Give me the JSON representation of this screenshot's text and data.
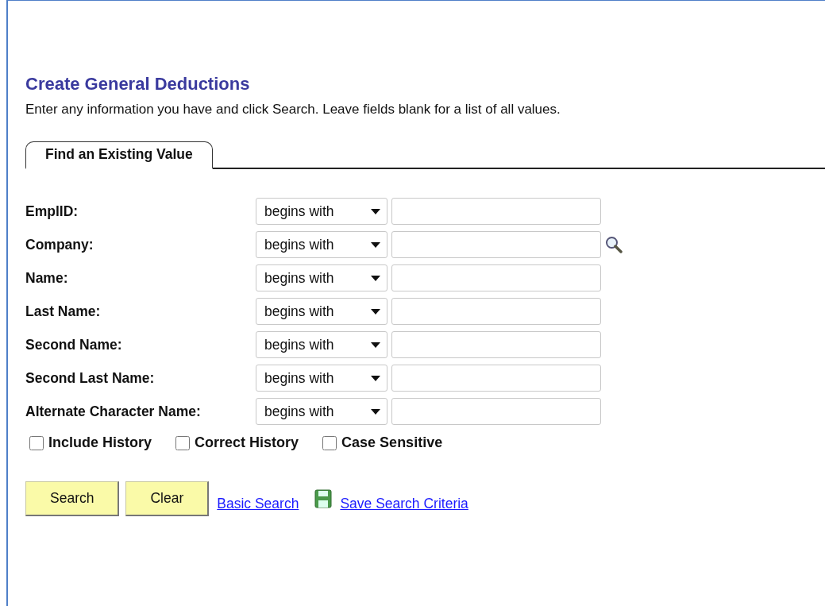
{
  "page": {
    "title": "Create General Deductions",
    "instructions": "Enter any information you have and click Search. Leave fields blank for a list of all values."
  },
  "tabs": [
    {
      "label": "Find an Existing Value",
      "selected": true
    }
  ],
  "fields": [
    {
      "label": "EmplID:",
      "operator": "begins with",
      "lookup": false
    },
    {
      "label": "Company:",
      "operator": "begins with",
      "lookup": true
    },
    {
      "label": "Name:",
      "operator": "begins with",
      "lookup": false
    },
    {
      "label": "Last Name:",
      "operator": "begins with",
      "lookup": false
    },
    {
      "label": "Second Name:",
      "operator": "begins with",
      "lookup": false
    },
    {
      "label": "Second Last Name:",
      "operator": "begins with",
      "lookup": false
    },
    {
      "label": "Alternate Character Name:",
      "operator": "begins with",
      "lookup": false
    }
  ],
  "options": [
    {
      "label": "Include History",
      "checked": false
    },
    {
      "label": "Correct History",
      "checked": false
    },
    {
      "label": "Case Sensitive",
      "checked": false
    }
  ],
  "buttons": [
    "Search",
    "Clear"
  ],
  "links": [
    {
      "label": "Basic Search",
      "icon": false
    },
    {
      "label": "Save Search Criteria",
      "icon": true
    }
  ]
}
